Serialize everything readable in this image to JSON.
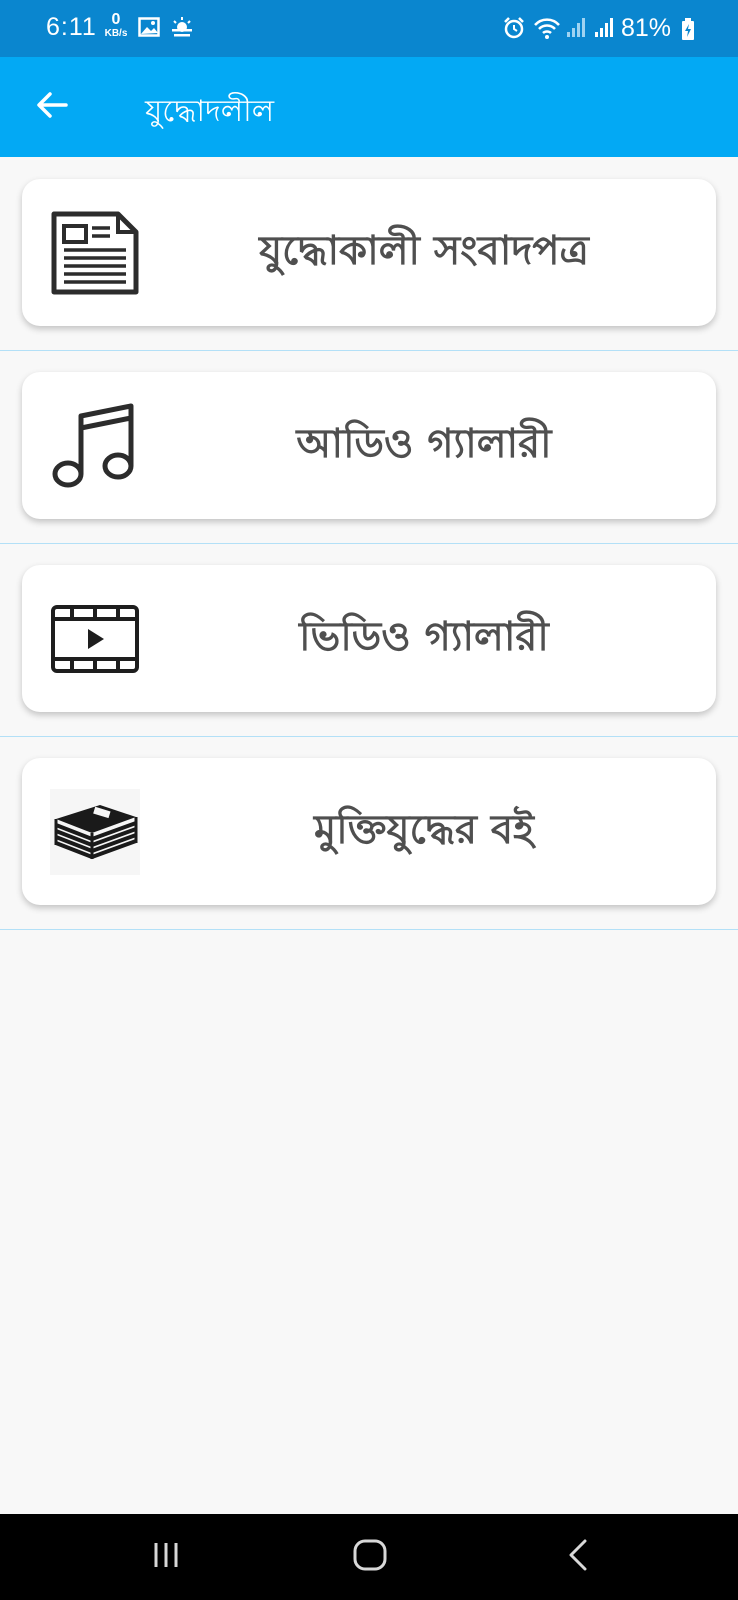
{
  "status_bar": {
    "time": "6:11",
    "net_speed_value": "0",
    "net_speed_unit": "KB/s",
    "battery_percent": "81%",
    "icons": [
      "image-icon",
      "weather-icon",
      "alarm-icon",
      "wifi-icon",
      "signal-icon",
      "signal-icon",
      "battery-charging-icon"
    ]
  },
  "app_bar": {
    "title": "যুদ্ধোদলীল",
    "back_icon": "arrow-left-icon"
  },
  "menu": {
    "items": [
      {
        "label": "যুদ্ধোকালী সংবাদপত্র",
        "icon": "newspaper-icon"
      },
      {
        "label": "আডিও গ্যালারী",
        "icon": "music-note-icon"
      },
      {
        "label": "ভিডিও গ্যালারী",
        "icon": "video-film-icon"
      },
      {
        "label": "মুক্তিযুদ্ধের বই",
        "icon": "books-stack-icon"
      }
    ]
  },
  "nav_bar": {
    "buttons": [
      "recent-apps-icon",
      "home-icon",
      "back-icon"
    ]
  },
  "colors": {
    "status_bar": "#0a86cf",
    "app_bar": "#03a9f4",
    "background": "#f8f8f8",
    "card": "#ffffff",
    "label_text": "#4f4f4f",
    "divider": "#b3e0f7"
  }
}
